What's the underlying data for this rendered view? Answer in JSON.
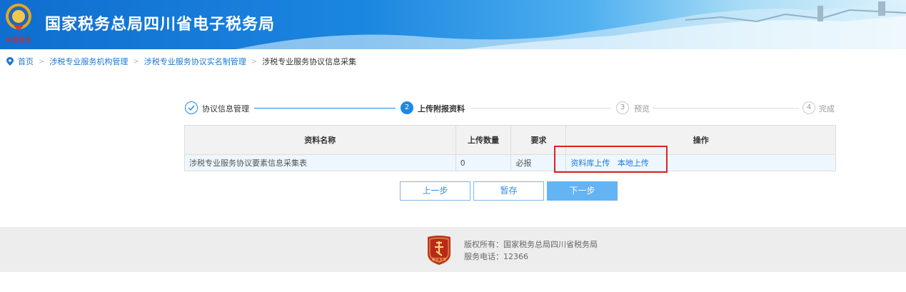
{
  "header": {
    "title": "国家税务总局四川省电子税务局",
    "emblem_caption": "中国税务"
  },
  "breadcrumb": {
    "items": [
      "首页",
      "涉税专业服务机构管理",
      "涉税专业服务协议实名制管理"
    ],
    "current": "涉税专业服务协议信息采集",
    "separator": ">"
  },
  "steps": [
    {
      "number": "✓",
      "label": "协议信息管理",
      "state": "done"
    },
    {
      "number": "2",
      "label": "上传附报资料",
      "state": "active"
    },
    {
      "number": "3",
      "label": "预览",
      "state": "todo"
    },
    {
      "number": "4",
      "label": "完成",
      "state": "todo"
    }
  ],
  "table": {
    "headers": [
      "资料名称",
      "上传数量",
      "要求",
      "操作"
    ],
    "rows": [
      {
        "name": "涉税专业服务协议要素信息采集表",
        "count": "0",
        "requirement": "必报",
        "actions": [
          "资料库上传",
          "本地上传"
        ]
      }
    ]
  },
  "buttons": {
    "prev": "上一步",
    "save": "暂存",
    "next": "下一步"
  },
  "footer": {
    "copyright": "版权所有：国家税务总局四川省税务局",
    "phone": "服务电话：12366",
    "badge_text": "税收宣传"
  },
  "colors": {
    "accent": "#1e88e5",
    "link": "#1e78d2",
    "highlight": "#e02020",
    "primary_button": "#64b3f2"
  }
}
